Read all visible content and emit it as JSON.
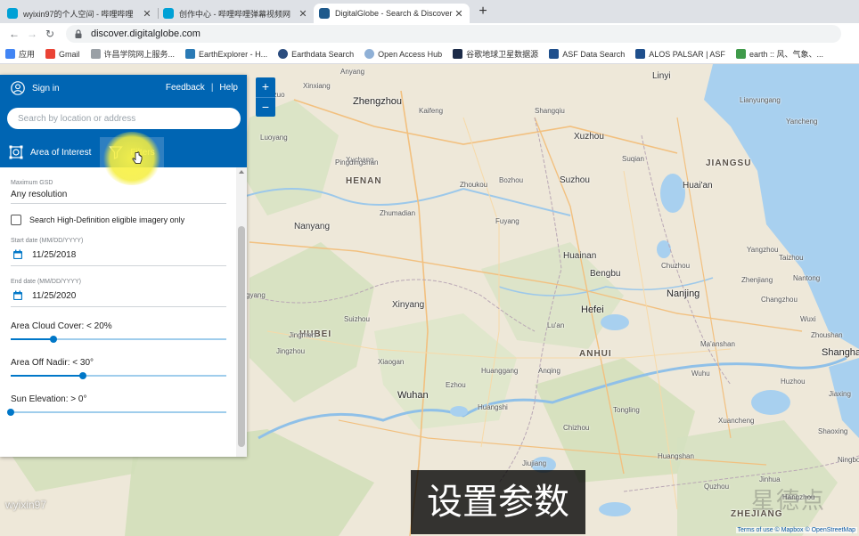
{
  "browser": {
    "tabs": [
      {
        "title": "wyixin97的个人空间 - 哔哩哔哩",
        "favicon_color": "#00a1d6",
        "active": false
      },
      {
        "title": "创作中心 - 哔哩哔哩弹幕视频网",
        "favicon_color": "#00a1d6",
        "active": false
      },
      {
        "title": "DigitalGlobe - Search & Discover",
        "favicon_color": "#1f5a8c",
        "active": true
      }
    ],
    "new_tab": "+",
    "url": "discover.digitalglobe.com"
  },
  "bookmarks": [
    {
      "label": "应用",
      "color": "#4285f4"
    },
    {
      "label": "Gmail",
      "color": "#ea4335"
    },
    {
      "label": "许昌学院网上服务...",
      "color": "#9aa0a6"
    },
    {
      "label": "EarthExplorer - H...",
      "color": "#2a7ab5"
    },
    {
      "label": "Earthdata Search",
      "color": "#2b4c7e"
    },
    {
      "label": "Open Access Hub",
      "color": "#8fb0d6"
    },
    {
      "label": "谷歌地球卫星数据源",
      "color": "#1c2b48"
    },
    {
      "label": "ASF Data Search",
      "color": "#1f4f8c"
    },
    {
      "label": "ALOS PALSAR | ASF",
      "color": "#1f4f8c"
    },
    {
      "label": "earth :: 风、气象、...",
      "color": "#3f9a4a"
    }
  ],
  "panel": {
    "sign_in": "Sign in",
    "feedback": "Feedback",
    "help": "Help",
    "search_placeholder": "Search by location or address",
    "tab_aoi": "Area of Interest",
    "tab_filters": "Filters",
    "max_gsd_label": "Maximum GSD",
    "max_gsd_value": "Any resolution",
    "hd_checkbox": "Search High-Definition eligible imagery only",
    "start_label": "Start date (MM/DD/YYYY)",
    "start_value": "11/25/2018",
    "end_label": "End date (MM/DD/YYYY)",
    "end_value": "11/25/2020",
    "cloud_label": "Area Cloud Cover: < 20%",
    "cloud_fraction": 0.2,
    "nadir_label": "Area Off Nadir: < 30°",
    "nadir_fraction": 0.333,
    "sun_label": "Sun Elevation: > 0°",
    "sun_fraction": 0.0
  },
  "map": {
    "zoom_in": "+",
    "zoom_out": "−",
    "provinces": [
      "HENAN",
      "JIANGSU",
      "HUBEI",
      "ANHUI",
      "ZHEJIANG"
    ],
    "major_cities": [
      "Zhengzhou",
      "Nanjing",
      "Wuhan",
      "Hefei",
      "Shanghai"
    ],
    "cities": [
      "Linyi",
      "Xuzhou",
      "Huai'an",
      "Bengbu",
      "Luoyang",
      "Xuchang",
      "Fuyang",
      "Nanyang",
      "Xinyang",
      "Anqing",
      "Jiujiang",
      "Huangshi",
      "Yancheng",
      "Suzhou",
      "Zhoukou",
      "Pingdingshan",
      "Zhumadian",
      "Xiangyang",
      "Jingmen",
      "Xiaogan",
      "Huainan",
      "Lu'an",
      "Wuhu",
      "Ma'anshan",
      "Hangzhou",
      "Shangqiu",
      "Kaifeng",
      "Bozhou",
      "Yangzhou",
      "Zhenjiang",
      "Changzhou",
      "Wuxi",
      "Taizhou",
      "Suqian",
      "Lianyungang",
      "Jiaozuo",
      "Xinxiang",
      "Anyang",
      "Suizhou",
      "Jingzhou",
      "Ezhou",
      "Huanggang",
      "Chuzhou",
      "Tongling",
      "Chizhou",
      "Huangshan",
      "Xuancheng",
      "Huzhou",
      "Jiaxing",
      "Shaoxing",
      "Jinhua",
      "Quzhou",
      "Ningbo",
      "Zhoushan",
      "Nantong"
    ],
    "attribution": "Terms of use © Mapbox © OpenStreetMap"
  },
  "overlay": {
    "subtitle": "设置参数",
    "watermark": "wyixin97"
  }
}
